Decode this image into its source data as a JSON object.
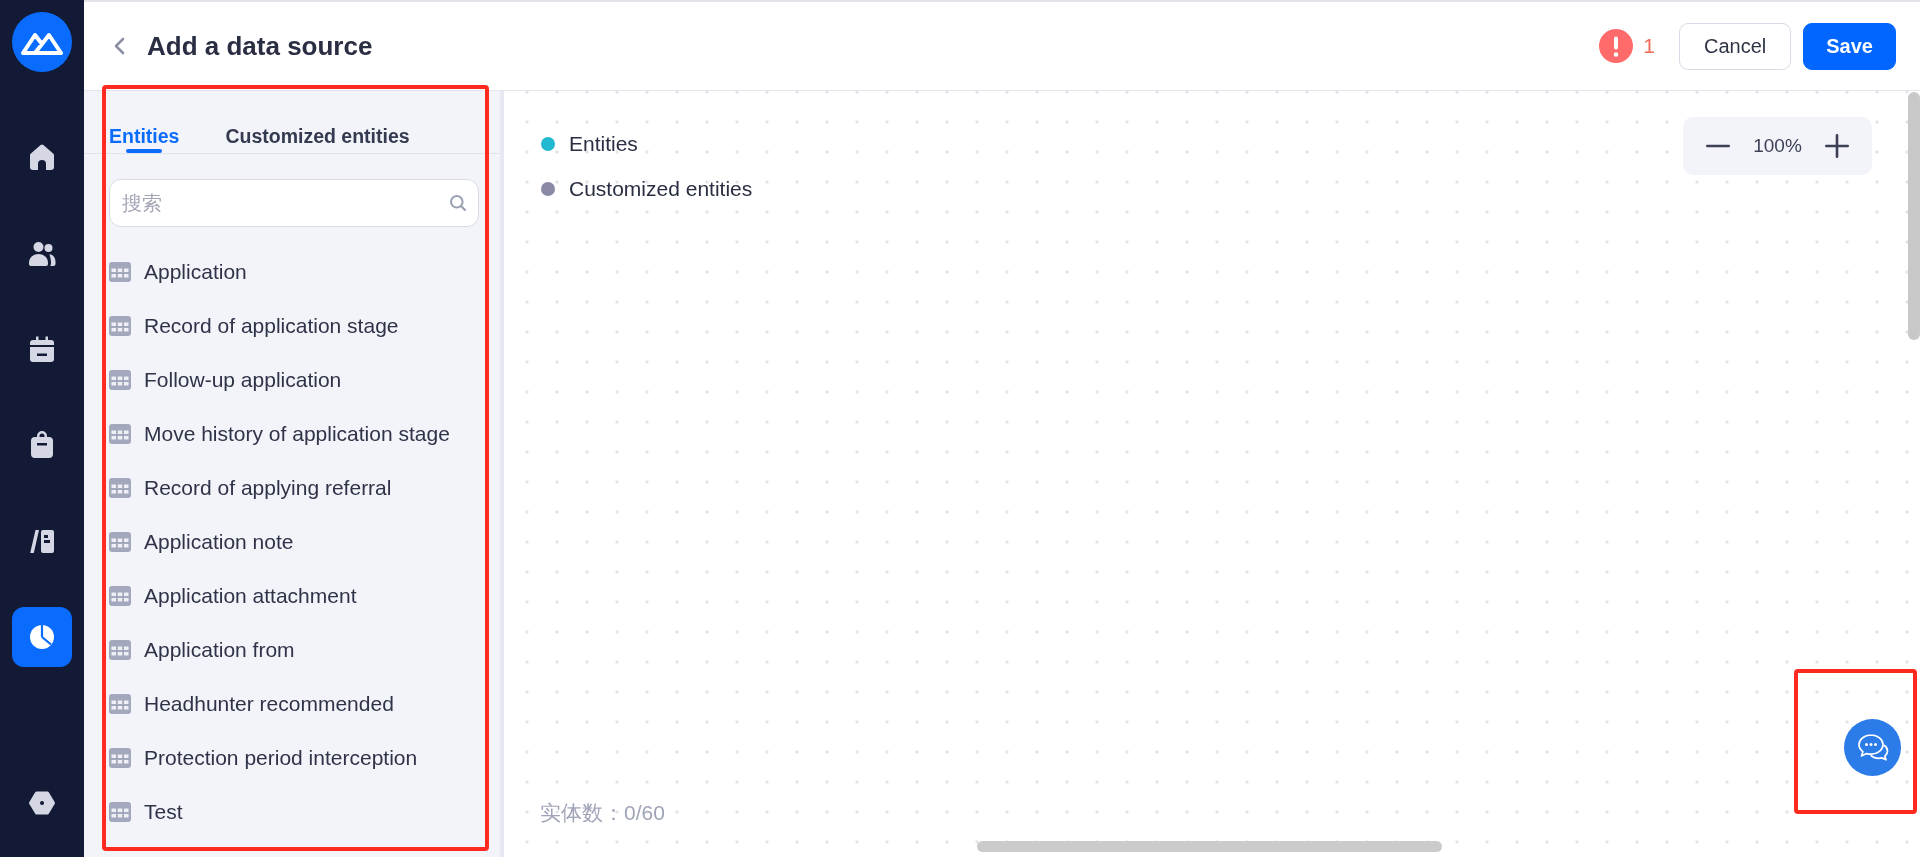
{
  "sidebar": {
    "items": [
      {
        "kind": "home",
        "selected": false
      },
      {
        "kind": "people",
        "selected": false
      },
      {
        "kind": "calendar",
        "selected": false
      },
      {
        "kind": "bag",
        "selected": false
      },
      {
        "kind": "cards",
        "selected": false
      },
      {
        "kind": "chart",
        "selected": true
      }
    ],
    "bottom_items": [
      {
        "kind": "settings",
        "selected": false
      }
    ]
  },
  "header": {
    "title": "Add a data source",
    "alert_count": "1",
    "buttons": [
      {
        "label": "Cancel",
        "kind": "secondary"
      },
      {
        "label": "Save",
        "kind": "primary"
      }
    ]
  },
  "panel": {
    "tabs": [
      {
        "label": "Entities",
        "selected": true
      },
      {
        "label": "Customized entities",
        "selected": false
      }
    ],
    "search": {
      "placeholder": "搜索"
    },
    "items": [
      {
        "label": "Application"
      },
      {
        "label": "Record of application stage"
      },
      {
        "label": "Follow-up application"
      },
      {
        "label": "Move history of application stage"
      },
      {
        "label": "Record of applying referral"
      },
      {
        "label": "Application note"
      },
      {
        "label": "Application attachment"
      },
      {
        "label": "Application from"
      },
      {
        "label": "Headhunter recommended"
      },
      {
        "label": "Protection period interception"
      },
      {
        "label": "Test"
      }
    ]
  },
  "canvas": {
    "legend": [
      {
        "label": "Entities",
        "color": "#22b8cf"
      },
      {
        "label": "Customized entities",
        "color": "#8a89a6"
      }
    ],
    "zoom": {
      "value": "100%"
    },
    "entity_count": "实体数：0/60"
  }
}
